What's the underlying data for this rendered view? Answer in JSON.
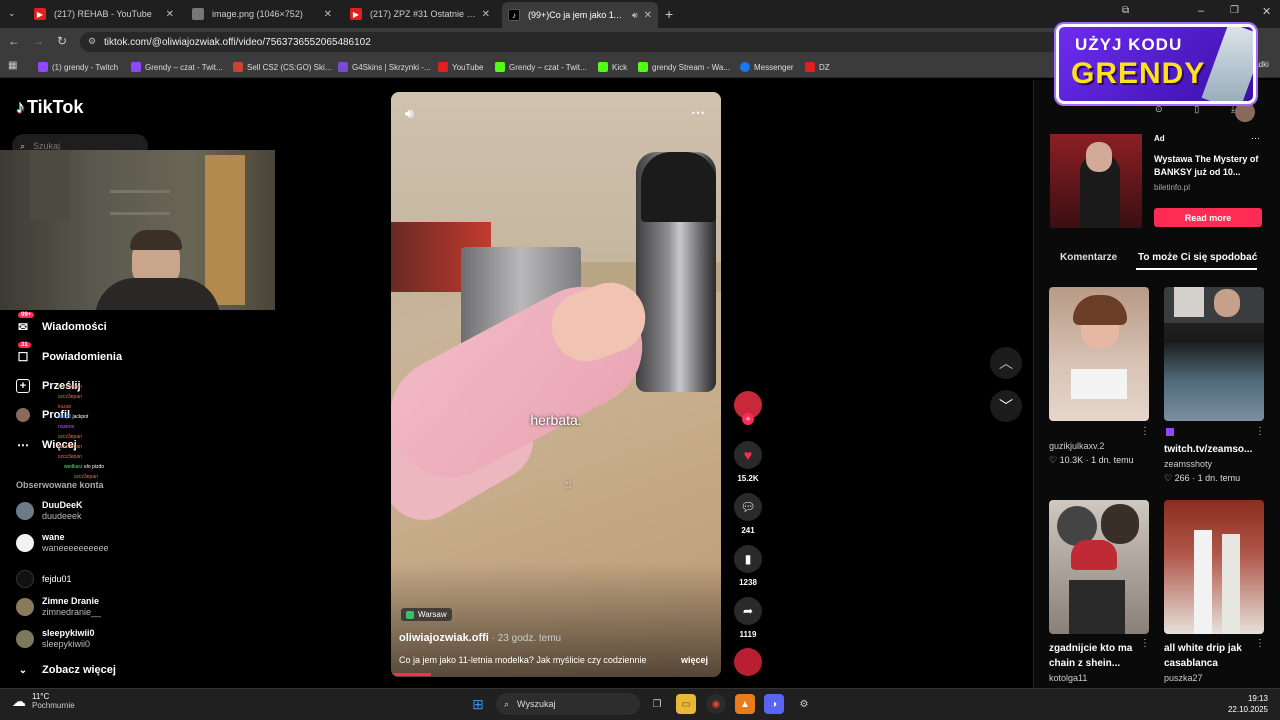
{
  "browser": {
    "tabs": [
      {
        "title": "(217) REHAB - YouTube",
        "icon": "youtube-icon"
      },
      {
        "title": "image.png (1046×752)",
        "icon": "image-icon"
      },
      {
        "title": "(217) ZPZ #31 Ostatnie pytanie",
        "icon": "youtube-icon"
      },
      {
        "title": "(99+)Co ja jem jako 11-letni",
        "icon": "tiktok-icon"
      }
    ],
    "url": "tiktok.com/@oliwiajozwiak.offi/video/7563736552065486102",
    "bookmarks": [
      "(1) grendy - Twitch",
      "Grendy – czat - Twit...",
      "Sell CS2 (CS:GO) Ski...",
      "G4Skins | Skrzynki -...",
      "YouTube",
      "Grendy – czat - Twit...",
      "Kick",
      "grendy Stream - Wa...",
      "Messenger",
      "DZ"
    ]
  },
  "tiktok": {
    "logo": "TikTok",
    "search_placeholder": "Szukaj",
    "nav": {
      "messages": "Wiadomości",
      "messages_badge": "99+",
      "notifications": "Powiadomienia",
      "notifications_badge": "31",
      "upload": "Prześlij",
      "profile": "Profil",
      "more": "Więcej"
    },
    "following_header": "Obserwowane konta",
    "following": [
      {
        "name": "DuuDeeK",
        "handle": "duudeeek"
      },
      {
        "name": "wane",
        "handle": "waneeeeeeeeee"
      },
      {
        "name": "fejdu01",
        "handle": ""
      },
      {
        "name": "Zimne Dranie",
        "handle": "zimnedranie__"
      },
      {
        "name": "sleepykiwii0",
        "handle": "sleepykiwii0"
      }
    ],
    "see_more": "Zobacz więcej"
  },
  "overlay_chat": [
    {
      "user": "szcz3epan",
      "msg": ""
    },
    {
      "user": "szcz3epan",
      "msg": ""
    },
    {
      "user": "kuzab",
      "msg": ""
    },
    {
      "user": "Betg0",
      "msg": "jackpot"
    },
    {
      "user": "nuxeno",
      "msg": ""
    },
    {
      "user": "szcz3epan",
      "msg": ""
    },
    {
      "user": "szcz3epan",
      "msg": ""
    },
    {
      "user": "szcz3epan",
      "msg": ""
    },
    {
      "user": "wedkarz",
      "msg": "elo pizdo"
    },
    {
      "user": "szcz3epan",
      "msg": ""
    }
  ],
  "video": {
    "caption_overlay": "herbata.",
    "location": "Warsaw",
    "author": "oliwiajozwiak.offi",
    "posted": " · 23 godz. temu",
    "description": "Co ja jem jako 11-letnia modelka? Jak myślicie czy codziennie",
    "more_link": "więcej",
    "likes": "15.2K",
    "comments": "241",
    "saves": "1238",
    "shares": "1119"
  },
  "sidebar_right": {
    "ad": {
      "label": "Ad",
      "title": "Wystawa The Mystery of BANKSY już od 10...",
      "source": "biletinfo.pl",
      "cta": "Read more"
    },
    "tabs": {
      "comments": "Komentarze",
      "recommended": "To może Ci się spodobać"
    },
    "videos": [
      {
        "title": "",
        "user": "guzikjulkaxv.2",
        "stats": "♡ 10.3K · 1 dn. temu"
      },
      {
        "title": "twitch.tv/zeamso...",
        "user": "zeamsshoty",
        "stats": "♡ 266 · 1 dn. temu"
      },
      {
        "title": "zgadnijcie kto ma chain z shein...",
        "user": "kotolga11",
        "stats": ""
      },
      {
        "title": "all white drip jak casablanca",
        "user": "puszka27",
        "stats": ""
      }
    ]
  },
  "promo": {
    "line1": "UŻYJ KODU",
    "line2": "GRENDY"
  },
  "taskbar": {
    "temp": "11°C",
    "weather": "Pochmurnie",
    "search": "Wyszukaj",
    "time": "19:13",
    "date": "22.10.2025"
  },
  "colors": {
    "accent": "#fe2c55",
    "promo": "#6d2cf0",
    "promo_text": "#ffe11a"
  }
}
